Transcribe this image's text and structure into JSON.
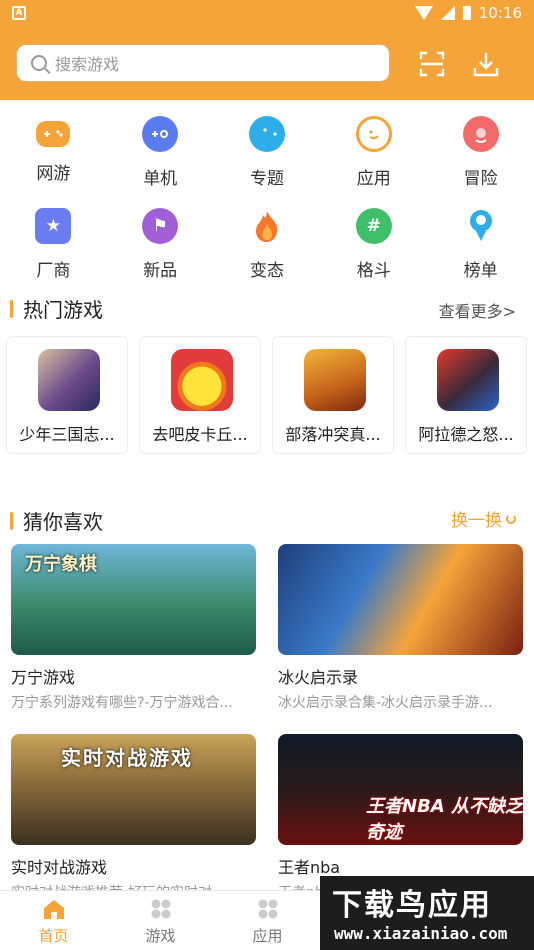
{
  "status_bar": {
    "time": "10:16",
    "app_icon_letter": "A"
  },
  "search": {
    "placeholder": "搜索游戏"
  },
  "categories": [
    {
      "label": "网游",
      "icon": "gamepad-icon",
      "color": "#f5a43a",
      "glyph": ""
    },
    {
      "label": "单机",
      "icon": "controller-icon",
      "color": "#5b7cf0",
      "glyph": ""
    },
    {
      "label": "专题",
      "icon": "pacman-icon",
      "color": "#2eaee8",
      "glyph": ""
    },
    {
      "label": "应用",
      "icon": "app-face-icon",
      "color": "#f5a43a",
      "glyph": ""
    },
    {
      "label": "冒险",
      "icon": "adventure-icon",
      "color": "#f36a6a",
      "glyph": ""
    },
    {
      "label": "厂商",
      "icon": "star-badge-icon",
      "color": "#6a7df0",
      "glyph": "★"
    },
    {
      "label": "新品",
      "icon": "flag-icon",
      "color": "#a05fd6",
      "glyph": "⚑"
    },
    {
      "label": "变态",
      "icon": "flame-icon",
      "color": "#f5772e",
      "glyph": ""
    },
    {
      "label": "格斗",
      "icon": "hashtag-chat-icon",
      "color": "#3fbf6a",
      "glyph": "#"
    },
    {
      "label": "榜单",
      "icon": "trophy-icon",
      "color": "#2eaee8",
      "glyph": ""
    }
  ],
  "hot": {
    "title": "热门游戏",
    "more": "查看更多>",
    "games": [
      {
        "name": "少年三国志...",
        "icon": "game-shaonian-icon"
      },
      {
        "name": "去吧皮卡丘...",
        "icon": "game-pikachu-icon"
      },
      {
        "name": "部落冲突真...",
        "icon": "game-clash-icon"
      },
      {
        "name": "阿拉德之怒...",
        "icon": "game-arad-icon"
      }
    ]
  },
  "guess": {
    "title": "猜你喜欢",
    "refresh": "换一换",
    "items": [
      {
        "title": "万宁游戏",
        "desc": "万宁系列游戏有哪些?-万宁游戏合...",
        "banner_text": "万宁象棋"
      },
      {
        "title": "冰火启示录",
        "desc": "冰火启示录合集-冰火启示录手游...",
        "banner_text": ""
      },
      {
        "title": "实时对战游戏",
        "desc": "实时对战游戏推荐-好玩的实时对...",
        "banner_text": "实时对战游戏"
      },
      {
        "title": "王者nba",
        "desc": "王者nba...",
        "banner_text": "王者NBA 从不缺乏奇迹"
      }
    ]
  },
  "tabs": [
    {
      "label": "首页",
      "icon": "home-icon",
      "active": true
    },
    {
      "label": "游戏",
      "icon": "grid-icon",
      "active": false
    },
    {
      "label": "应用",
      "icon": "apps-icon",
      "active": false
    }
  ],
  "watermark": {
    "main": "下载鸟应用",
    "url": "www.xiazainiao.com"
  },
  "colors": {
    "accent": "#f5a43a"
  }
}
